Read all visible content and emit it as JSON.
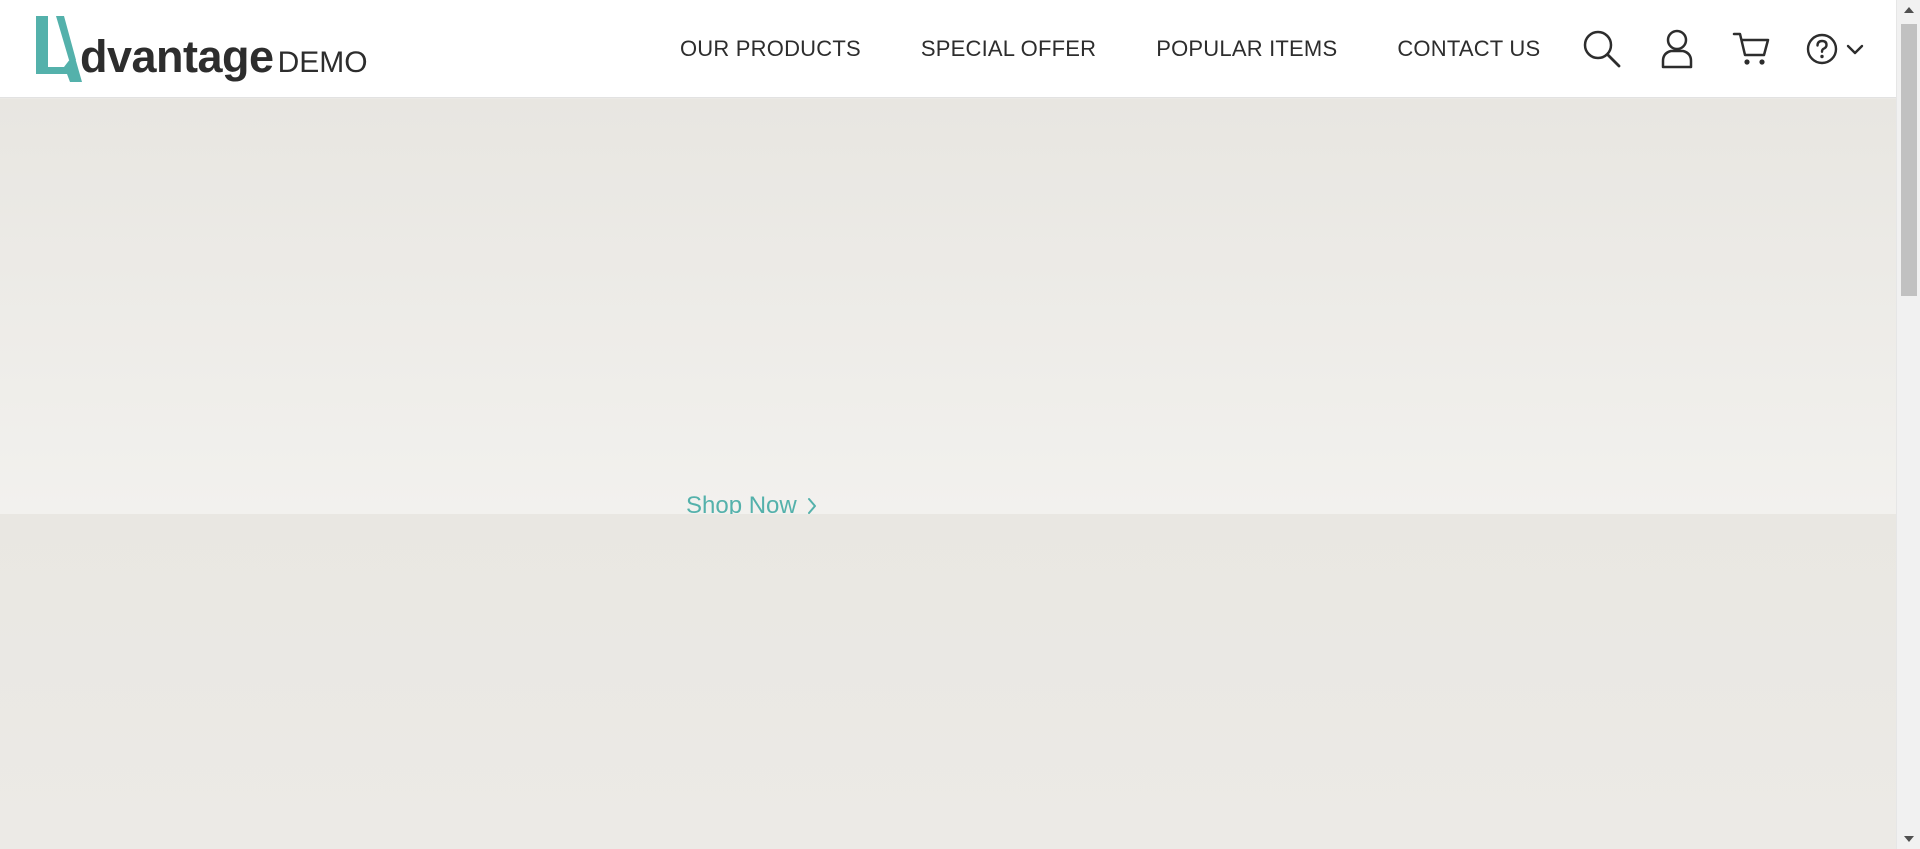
{
  "logo": {
    "name": "dvantage",
    "suffix": "DEMO",
    "accent_color": "#54b1ab"
  },
  "nav": {
    "items": [
      {
        "label": "OUR PRODUCTS"
      },
      {
        "label": "SPECIAL OFFER"
      },
      {
        "label": "POPULAR ITEMS"
      },
      {
        "label": "CONTACT US"
      }
    ]
  },
  "header_icons": [
    "search-icon",
    "user-icon",
    "cart-icon",
    "help-icon",
    "chevron-down-icon"
  ],
  "hero": {
    "cta_label": "Shop Now",
    "cta_color": "#54b1ab"
  }
}
